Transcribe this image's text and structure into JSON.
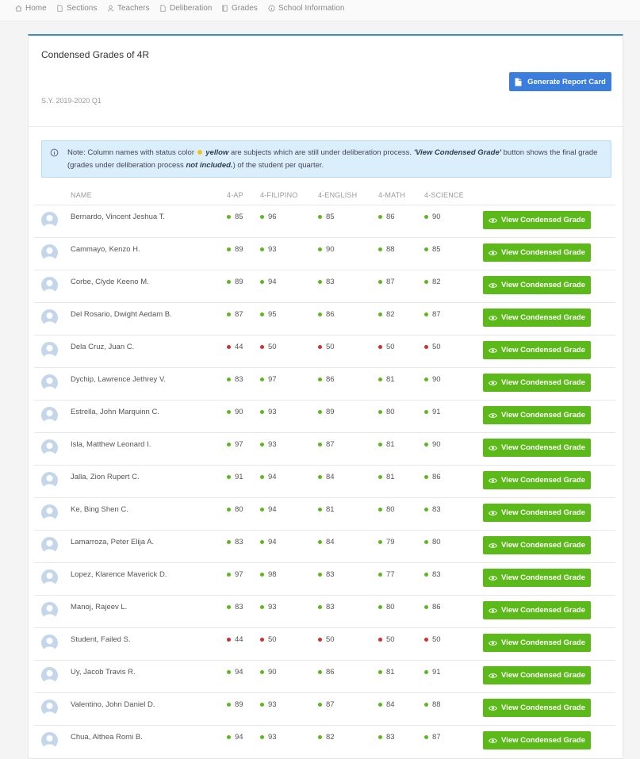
{
  "nav": [
    {
      "label": "Home",
      "icon": "home-icon"
    },
    {
      "label": "Sections",
      "icon": "document-icon"
    },
    {
      "label": "Teachers",
      "icon": "user-icon"
    },
    {
      "label": "Deliberation",
      "icon": "document-icon"
    },
    {
      "label": "Grades",
      "icon": "book-icon"
    },
    {
      "label": "School Information",
      "icon": "info-icon"
    }
  ],
  "page": {
    "title": "Condensed Grades of 4R",
    "school_year": "S.Y. 2019-2020 Q1",
    "report_button": "Generate Report Card"
  },
  "note": {
    "text_1": "Note: Column names with status color",
    "highlight_1": "yellow",
    "text_2": "are subjects which are still under deliberation process.",
    "highlight_2": "'View Condensed Grade'",
    "text_3": "button shows the final grade (grades under deliberation process",
    "highlight_3": "not included.",
    "text_4": ") of the student per quarter."
  },
  "columns": {
    "name": "NAME",
    "subjects": [
      "4-AP",
      "4-FILIPINO",
      "4-ENGLISH",
      "4-MATH",
      "4-SCIENCE"
    ]
  },
  "view_button_label": "View Condensed Grade",
  "colors": {
    "accent": "#3c8dcc",
    "pass": "#5cb91a",
    "fail": "#d32f2f",
    "deliberation": "#f0c419",
    "view_button": "#5cb91a",
    "report_button": "#3b7ddd"
  },
  "students": [
    {
      "name": "Bernardo, Vincent Jeshua T.",
      "grades": [
        85,
        96,
        85,
        86,
        90
      ],
      "status": [
        "pass",
        "pass",
        "pass",
        "pass",
        "pass"
      ]
    },
    {
      "name": "Cammayo, Kenzo H.",
      "grades": [
        89,
        93,
        90,
        88,
        85
      ],
      "status": [
        "pass",
        "pass",
        "pass",
        "pass",
        "pass"
      ]
    },
    {
      "name": "Corbe, Clyde Keeno M.",
      "grades": [
        89,
        94,
        83,
        87,
        82
      ],
      "status": [
        "pass",
        "pass",
        "pass",
        "pass",
        "pass"
      ]
    },
    {
      "name": "Del Rosario, Dwight Aedam B.",
      "grades": [
        87,
        95,
        86,
        82,
        87
      ],
      "status": [
        "pass",
        "pass",
        "pass",
        "pass",
        "pass"
      ]
    },
    {
      "name": "Dela Cruz, Juan C.",
      "grades": [
        44,
        50,
        50,
        50,
        50
      ],
      "status": [
        "fail",
        "fail",
        "fail",
        "fail",
        "fail"
      ]
    },
    {
      "name": "Dychip, Lawrence Jethrey V.",
      "grades": [
        83,
        97,
        86,
        81,
        90
      ],
      "status": [
        "pass",
        "pass",
        "pass",
        "pass",
        "pass"
      ]
    },
    {
      "name": "Estrella, John Marquinn C.",
      "grades": [
        90,
        93,
        89,
        80,
        91
      ],
      "status": [
        "pass",
        "pass",
        "pass",
        "pass",
        "pass"
      ]
    },
    {
      "name": "Isla, Matthew Leonard I.",
      "grades": [
        97,
        93,
        87,
        81,
        90
      ],
      "status": [
        "pass",
        "pass",
        "pass",
        "pass",
        "pass"
      ]
    },
    {
      "name": "Jalla, Zion Rupert C.",
      "grades": [
        91,
        94,
        84,
        81,
        86
      ],
      "status": [
        "pass",
        "pass",
        "pass",
        "pass",
        "pass"
      ]
    },
    {
      "name": "Ke, Bing Shen C.",
      "grades": [
        80,
        94,
        81,
        80,
        83
      ],
      "status": [
        "pass",
        "pass",
        "pass",
        "pass",
        "pass"
      ]
    },
    {
      "name": "Lamarroza, Peter Elija A.",
      "grades": [
        83,
        94,
        84,
        79,
        80
      ],
      "status": [
        "pass",
        "pass",
        "pass",
        "pass",
        "pass"
      ]
    },
    {
      "name": "Lopez, Klarence Maverick D.",
      "grades": [
        97,
        98,
        83,
        77,
        83
      ],
      "status": [
        "pass",
        "pass",
        "pass",
        "pass",
        "pass"
      ]
    },
    {
      "name": "Manoj, Rajeev L.",
      "grades": [
        83,
        93,
        83,
        80,
        86
      ],
      "status": [
        "pass",
        "pass",
        "pass",
        "pass",
        "pass"
      ]
    },
    {
      "name": "Student, Failed S.",
      "grades": [
        44,
        50,
        50,
        50,
        50
      ],
      "status": [
        "fail",
        "fail",
        "fail",
        "fail",
        "fail"
      ]
    },
    {
      "name": "Uy, Jacob Travis R.",
      "grades": [
        94,
        90,
        86,
        81,
        91
      ],
      "status": [
        "pass",
        "pass",
        "pass",
        "pass",
        "pass"
      ]
    },
    {
      "name": "Valentino, John Daniel D.",
      "grades": [
        89,
        93,
        87,
        84,
        88
      ],
      "status": [
        "pass",
        "pass",
        "pass",
        "pass",
        "pass"
      ]
    },
    {
      "name": "Chua, Althea Romi B.",
      "grades": [
        94,
        93,
        82,
        83,
        87
      ],
      "status": [
        "pass",
        "pass",
        "pass",
        "pass",
        "pass"
      ]
    }
  ]
}
